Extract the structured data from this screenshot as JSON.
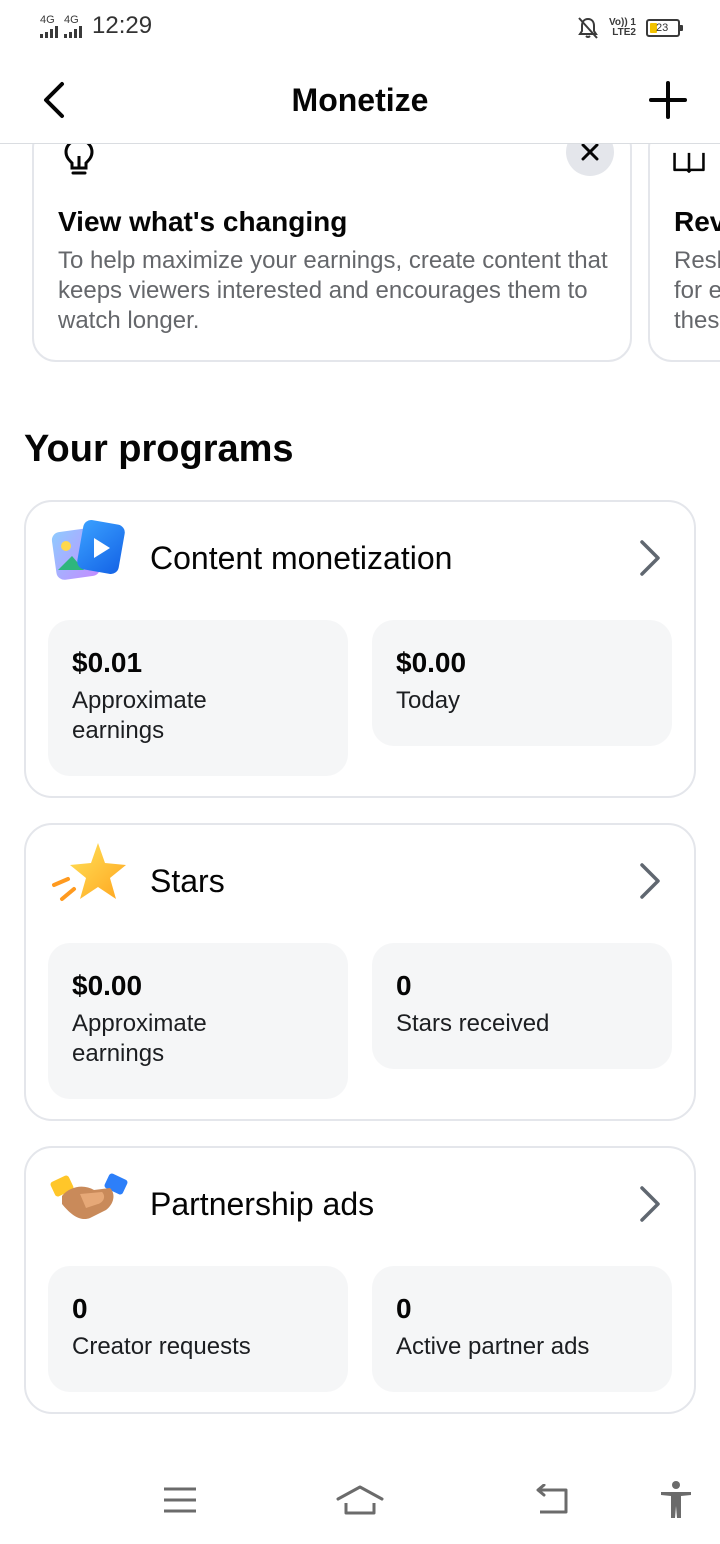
{
  "status_bar": {
    "signal1_label": "4G",
    "signal2_label": "4G",
    "time": "12:29",
    "volte_line1": "Vo)) 1",
    "volte_line2": "LTE2",
    "battery_level": "23"
  },
  "header": {
    "title": "Monetize",
    "back_icon": "chevron-left-icon",
    "add_icon": "plus-icon"
  },
  "tips": [
    {
      "icon": "lightbulb-icon",
      "title": "View what's changing",
      "body": "To help maximize your earnings, create content that keeps viewers interested and encourages them to watch longer.",
      "close_icon": "close-icon"
    },
    {
      "icon": "book-icon",
      "title": "Rev",
      "body_lines": [
        "Resh",
        "for e",
        "thes"
      ]
    }
  ],
  "programs_title": "Your programs",
  "programs": [
    {
      "icon": "content-monetization-icon",
      "title": "Content monetization",
      "stats": [
        {
          "value": "$0.01",
          "label": "Approximate earnings"
        },
        {
          "value": "$0.00",
          "label": "Today"
        }
      ]
    },
    {
      "icon": "star-icon",
      "title": "Stars",
      "stats": [
        {
          "value": "$0.00",
          "label": "Approximate earnings"
        },
        {
          "value": "0",
          "label": "Stars received"
        }
      ]
    },
    {
      "icon": "handshake-icon",
      "title": "Partnership ads",
      "stats": [
        {
          "value": "0",
          "label": "Creator requests"
        },
        {
          "value": "0",
          "label": "Active partner ads"
        }
      ]
    }
  ],
  "nav_bar": {
    "items": [
      "menu-icon",
      "home-icon",
      "back-icon",
      "accessibility-icon"
    ]
  },
  "colors": {
    "card_border": "#e4e6eb",
    "stat_background": "#f5f6f7",
    "secondary_text": "#65676b",
    "battery_fill": "#f2c200"
  }
}
